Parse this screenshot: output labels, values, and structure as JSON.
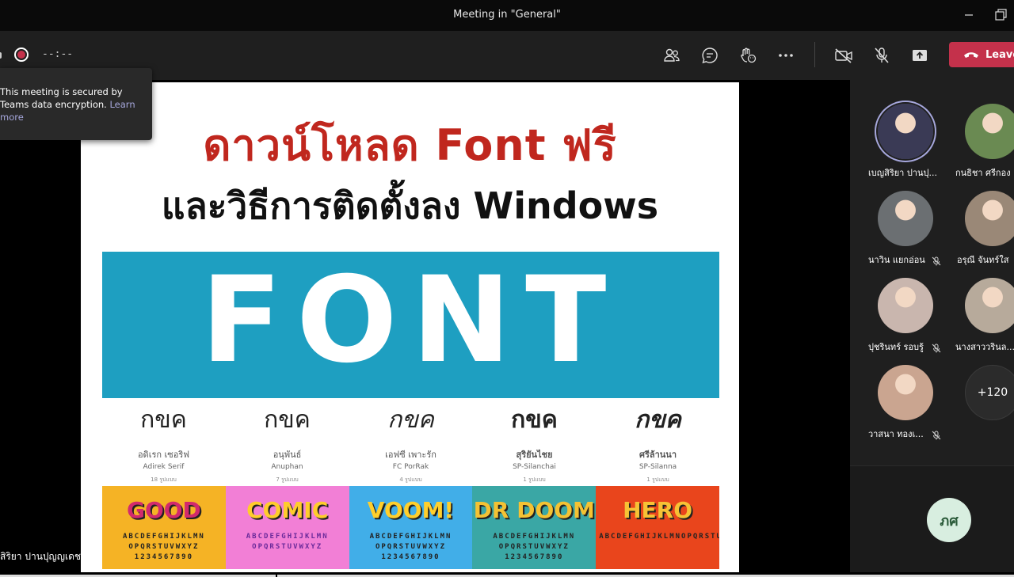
{
  "window": {
    "title": "Meeting in \"General\""
  },
  "toolbar": {
    "timer": "--:--",
    "leave_label": "Leave",
    "icons": [
      "participants-icon",
      "chat-icon",
      "reactions-icon",
      "more-icon",
      "camera-off-icon",
      "mic-off-icon",
      "share-icon",
      "phone-icon"
    ]
  },
  "toast": {
    "text": "This meeting is secured by Teams data encryption.",
    "link": "Learn more"
  },
  "slide": {
    "title_line1": "ดาวน์โหลด Font ฟรี",
    "title_line2": "และวิธีการติดตั้งลง Windows",
    "banner": "FONT",
    "samples": [
      {
        "glyph": "กขค",
        "thai": "อดิเรก เซอริฟ",
        "latin": "Adirek Serif",
        "count": "18 รูปแบบ"
      },
      {
        "glyph": "กขค",
        "thai": "อนุพันธ์",
        "latin": "Anuphan",
        "count": "7 รูปแบบ"
      },
      {
        "glyph": "กขค",
        "thai": "เอฟซี เพาะรัก",
        "latin": "FC PorRak",
        "count": "4 รูปแบบ"
      },
      {
        "glyph": "กขค",
        "thai": "สุริยันไชย",
        "latin": "SP-Silanchai",
        "count": "1 รูปแบบ"
      },
      {
        "glyph": "กขค",
        "thai": "ศรีล้านนา",
        "latin": "SP-Silanna",
        "count": "1 รูปแบบ"
      }
    ],
    "tiles": [
      {
        "big": "GOOD",
        "small": "ABCDEFGHIJKLMN OPQRSTUVWXYZ 1234567890",
        "bg": "#f5b325",
        "fg": "#d22a6d"
      },
      {
        "big": "COMIC",
        "small": "ABCDEFGHIJKLMN OPQRSTUVWXYZ",
        "bg": "#f27fd6",
        "fg": "#ffcc2b"
      },
      {
        "big": "VOOM!",
        "small": "ABCDEFGHIJKLMN OPQRSTUVWXYZ 1234567890",
        "bg": "#41aee8",
        "fg": "#ffcf2c"
      },
      {
        "big": "DR DOOM",
        "small": "ABCDEFGHIJKLMN OPQRSTUVWXYZ 1234567890",
        "bg": "#3aa7a5",
        "fg": "#f4c233"
      },
      {
        "big": "HERO",
        "small": "ABCDEFGHIJKLMNOPQRSTUVWXYZ",
        "bg": "#e9451c",
        "fg": "#f7c235"
      }
    ]
  },
  "stage": {
    "presenter_name": "สิริยา ปานปุญญเดช"
  },
  "participants": [
    {
      "name": "เบญสิริยา ปานปุ...",
      "muted": false,
      "speaking": true,
      "color": "#3a3a55"
    },
    {
      "name": "กนธิชา ศรีกอง",
      "muted": false,
      "speaking": false,
      "color": "#6a8a52"
    },
    {
      "name": "นาวิน แยกอ่อน",
      "muted": true,
      "speaking": false,
      "color": "#6b6f72"
    },
    {
      "name": "อรุณี จันทร์ใส",
      "muted": false,
      "speaking": false,
      "color": "#9a8877"
    },
    {
      "name": "ปุชรินทร์ รอบรู้",
      "muted": true,
      "speaking": false,
      "color": "#c9b6ae"
    },
    {
      "name": "นางสาววรินล...",
      "muted": false,
      "speaking": false,
      "color": "#b7aa9b"
    },
    {
      "name": "วาสนา ทองเ...",
      "muted": true,
      "speaking": false,
      "color": "#caa590"
    }
  ],
  "more_count": "+120",
  "me_initials": "ภศ"
}
